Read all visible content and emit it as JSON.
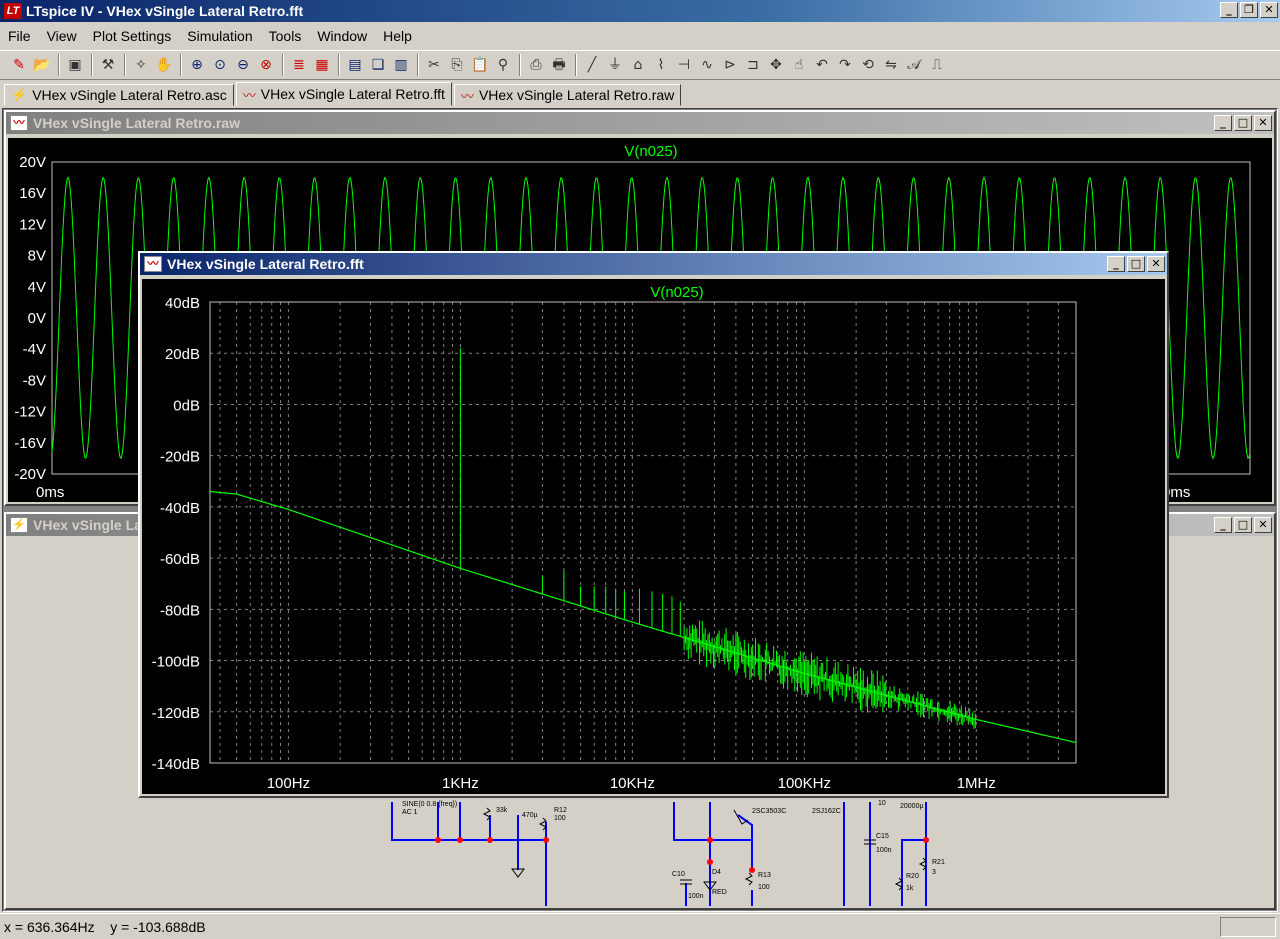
{
  "app": {
    "title": "LTspice IV - VHex vSingle Lateral Retro.fft",
    "icon_text": "LT"
  },
  "window_buttons": [
    "minimize",
    "restore",
    "close"
  ],
  "menu": [
    "File",
    "View",
    "Plot Settings",
    "Simulation",
    "Tools",
    "Window",
    "Help"
  ],
  "toolbar": {
    "icons": [
      "new-schematic-icon",
      "open-icon",
      "save-icon",
      "control-panel-icon",
      "run-icon",
      "pan-icon",
      "zoom-in-icon",
      "zoom-out-icon",
      "zoom-full-icon",
      "zoom-cancel-icon",
      "autorange-icon",
      "grid-icon",
      "tile-horizontal-icon",
      "cascade-icon",
      "tile-vertical-icon",
      "cut-icon",
      "copy-icon",
      "paste-icon",
      "find-icon",
      "print-preview-icon",
      "print-icon",
      "wire-icon",
      "ground-icon",
      "label-icon",
      "resistor-icon",
      "capacitor-icon",
      "inductor-icon",
      "diode-icon",
      "component-icon",
      "move-icon",
      "drag-icon",
      "undo-icon",
      "redo-icon",
      "rotate-icon",
      "mirror-icon",
      "text-icon",
      "spice-directive-icon"
    ]
  },
  "tabs": [
    {
      "label": "VHex vSingle Lateral Retro.asc",
      "icon": "schematic-icon"
    },
    {
      "label": "VHex vSingle Lateral Retro.fft",
      "icon": "waveform-icon",
      "active": true
    },
    {
      "label": "VHex vSingle Lateral Retro.raw",
      "icon": "waveform-icon"
    }
  ],
  "raw_window": {
    "title": "VHex vSingle Lateral Retro.raw",
    "trace": "V(n025)",
    "y_ticks": [
      "20V",
      "16V",
      "12V",
      "8V",
      "4V",
      "0V",
      "-4V",
      "-8V",
      "-12V",
      "-16V",
      "-20V"
    ],
    "x_start": "0ms",
    "x_end_partial": "0ms"
  },
  "asc_window": {
    "title_partial": "VHex vSingle La"
  },
  "fft_window": {
    "title": "VHex vSingle Lateral Retro.fft"
  },
  "schematic_labels": {
    "source": "SINE(0 0.8 {freq})",
    "source_ac": "AC 1",
    "r_33k": "33k",
    "c_470u": "470µ",
    "r12": "R12",
    "r12_val": "100",
    "q": "2SC3503C",
    "j": "2SJ162C",
    "c15": "C15",
    "c15_val": "100n",
    "val_10": "10",
    "val_20000u": "20000µ",
    "c10": "C10",
    "c10_val": "100n",
    "d4": "D4",
    "d4_val": "RED",
    "r13": "R13",
    "r13_val": "100",
    "r20": "R20",
    "r20_val": "1k",
    "r21": "R21",
    "r21_val": "3"
  },
  "status": {
    "text": "x = 636.364Hz    y = -103.688dB"
  },
  "colors": {
    "trace": "#00ff00",
    "grid": "#808080",
    "plot_bg": "#000000",
    "wire": "#0000ff",
    "junction": "#ff0000"
  },
  "chart_data": [
    {
      "type": "line",
      "title": "V(n025)",
      "xlabel": "",
      "ylabel": "",
      "x_range_label": [
        "0ms",
        ""
      ],
      "ylim": [
        -20,
        20
      ],
      "y_ticks": [
        "20V",
        "16V",
        "12V",
        "8V",
        "4V",
        "0V",
        "-4V",
        "-8V",
        "-12V",
        "-16V",
        "-20V"
      ],
      "series": [
        {
          "name": "V(n025)",
          "waveform": "sine",
          "amplitude_V": 18,
          "offset_V": 0,
          "cycles_visible": 34
        }
      ]
    },
    {
      "type": "line",
      "title": "V(n025)",
      "xscale": "log",
      "xlim_Hz": [
        35,
        3800000
      ],
      "x_ticks": [
        "100Hz",
        "1KHz",
        "10KHz",
        "100KHz",
        "1MHz"
      ],
      "x_tick_values": [
        100,
        1000,
        10000,
        100000,
        1000000
      ],
      "ylim": [
        -140,
        40
      ],
      "y_ticks": [
        "40dB",
        "20dB",
        "0dB",
        "-20dB",
        "-40dB",
        "-60dB",
        "-80dB",
        "-100dB",
        "-120dB",
        "-140dB"
      ],
      "y_tick_values": [
        40,
        20,
        0,
        -20,
        -40,
        -60,
        -80,
        -100,
        -120,
        -140
      ],
      "series": [
        {
          "name": "V(n025)",
          "noise_floor": [
            [
              35,
              -34
            ],
            [
              50,
              -35
            ],
            [
              100,
              -41
            ],
            [
              1000,
              -64
            ],
            [
              10000,
              -85
            ],
            [
              100000,
              -105
            ],
            [
              1000000,
              -123
            ],
            [
              3800000,
              -132
            ]
          ]
        }
      ],
      "peaks": [
        {
          "x": 1000,
          "y": 22
        },
        {
          "x": 3000,
          "y": -67
        },
        {
          "x": 4000,
          "y": -65
        },
        {
          "x": 5000,
          "y": -71
        },
        {
          "x": 6000,
          "y": -71
        },
        {
          "x": 7000,
          "y": -71
        },
        {
          "x": 8000,
          "y": -72
        },
        {
          "x": 9000,
          "y": -73
        },
        {
          "x": 11000,
          "y": -72
        },
        {
          "x": 13000,
          "y": -73
        },
        {
          "x": 15000,
          "y": -74
        },
        {
          "x": 17000,
          "y": -75
        },
        {
          "x": 19000,
          "y": -77
        }
      ]
    }
  ]
}
